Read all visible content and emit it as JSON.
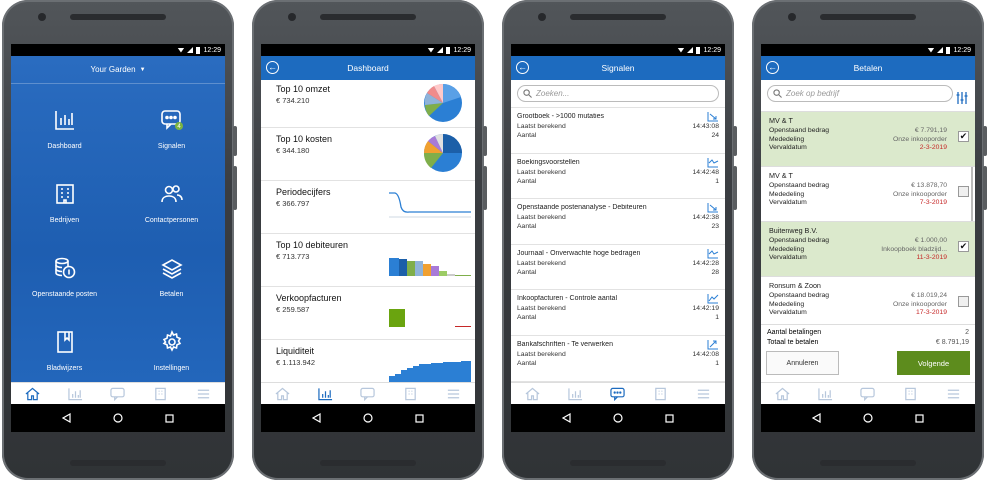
{
  "status": {
    "time": "12:29"
  },
  "screen1": {
    "org_name": "Your Garden",
    "tiles": [
      {
        "label": "Dashboard",
        "icon": "bar-chart-icon"
      },
      {
        "label": "Signalen",
        "icon": "chat-bubble-icon",
        "badge": "4"
      },
      {
        "label": "Bedrijven",
        "icon": "building-icon"
      },
      {
        "label": "Contactpersonen",
        "icon": "people-icon"
      },
      {
        "label": "Openstaande posten",
        "icon": "coins-icon"
      },
      {
        "label": "Betalen",
        "icon": "money-stack-icon"
      },
      {
        "label": "Bladwijzers",
        "icon": "bookmark-icon"
      },
      {
        "label": "Instellingen",
        "icon": "gear-icon"
      }
    ]
  },
  "screen2": {
    "title": "Dashboard",
    "items": [
      {
        "title": "Top 10 omzet",
        "value": "€ 734.210",
        "chart": "pie"
      },
      {
        "title": "Top 10 kosten",
        "value": "€ 344.180",
        "chart": "pie"
      },
      {
        "title": "Periodecijfers",
        "value": "€ 366.797",
        "chart": "line"
      },
      {
        "title": "Top 10 debiteuren",
        "value": "€ 713.773",
        "chart": "bars"
      },
      {
        "title": "Verkoopfacturen",
        "value": "€ 259.587",
        "chart": "bars"
      },
      {
        "title": "Liquiditeit",
        "value": "€ 1.113.942",
        "chart": "bars"
      }
    ]
  },
  "screen3": {
    "title": "Signalen",
    "search_placeholder": "Zoeken...",
    "items": [
      {
        "title": "Grootboek - >1000 mutaties",
        "calc_label": "Laatst berekend",
        "time": "14:43:08",
        "count_label": "Aantal",
        "count": "24"
      },
      {
        "title": "Boekingsvoorstellen",
        "calc_label": "Laatst berekend",
        "time": "14:42:48",
        "count_label": "Aantal",
        "count": "1"
      },
      {
        "title": "Openstaande postenanalyse - Debiteuren",
        "calc_label": "Laatst berekend",
        "time": "14:42:38",
        "count_label": "Aantal",
        "count": "23"
      },
      {
        "title": "Journaal - Onverwachte hoge bedragen",
        "calc_label": "Laatst berekend",
        "time": "14:42:28",
        "count_label": "Aantal",
        "count": "28"
      },
      {
        "title": "Inkoopfacturen - Controle  aantal",
        "calc_label": "Laatst berekend",
        "time": "14:42:19",
        "count_label": "Aantal",
        "count": "1"
      },
      {
        "title": "Bankafschriften - Te verwerken",
        "calc_label": "Laatst berekend",
        "time": "14:42:08",
        "count_label": "Aantal",
        "count": "1"
      }
    ]
  },
  "screen4": {
    "title": "Betalen",
    "search_placeholder": "Zoek op bedrijf",
    "items": [
      {
        "name": "MV & T",
        "amount_label": "Openstaand bedrag",
        "amount": "€ 7.791,19",
        "note_label": "Mededeling",
        "note": "Onze inkooporder",
        "due_label": "Vervaldatum",
        "due": "2-3-2019",
        "selected": true
      },
      {
        "name": "MV & T",
        "amount_label": "Openstaand bedrag",
        "amount": "€ 13.878,70",
        "note_label": "Mededeling",
        "note": "Onze inkooporder",
        "due_label": "Vervaldatum",
        "due": "7-3-2019",
        "selected": false
      },
      {
        "name": "Buitenweg B.V.",
        "amount_label": "Openstaand bedrag",
        "amount": "€ 1.000,00",
        "note_label": "Mededeling",
        "note": "Inkoopboek bladzijd...",
        "due_label": "Vervaldatum",
        "due": "11-3-2019",
        "selected": true
      },
      {
        "name": "Ronsum & Zoon",
        "amount_label": "Openstaand bedrag",
        "amount": "€ 18.019,24",
        "note_label": "Mededeling",
        "note": "Onze inkooporder",
        "due_label": "Vervaldatum",
        "due": "17-3-2019",
        "selected": false
      }
    ],
    "footer": {
      "count_label": "Aantal betalingen",
      "count": "2",
      "total_label": "Totaal te betalen",
      "total": "€ 8.791,19",
      "cancel": "Annuleren",
      "next": "Volgende"
    }
  },
  "colors": {
    "primary": "#1d6bbf",
    "selected_row": "#dbe9cc",
    "next_button": "#5d8c1d",
    "due_red": "#c62828"
  }
}
